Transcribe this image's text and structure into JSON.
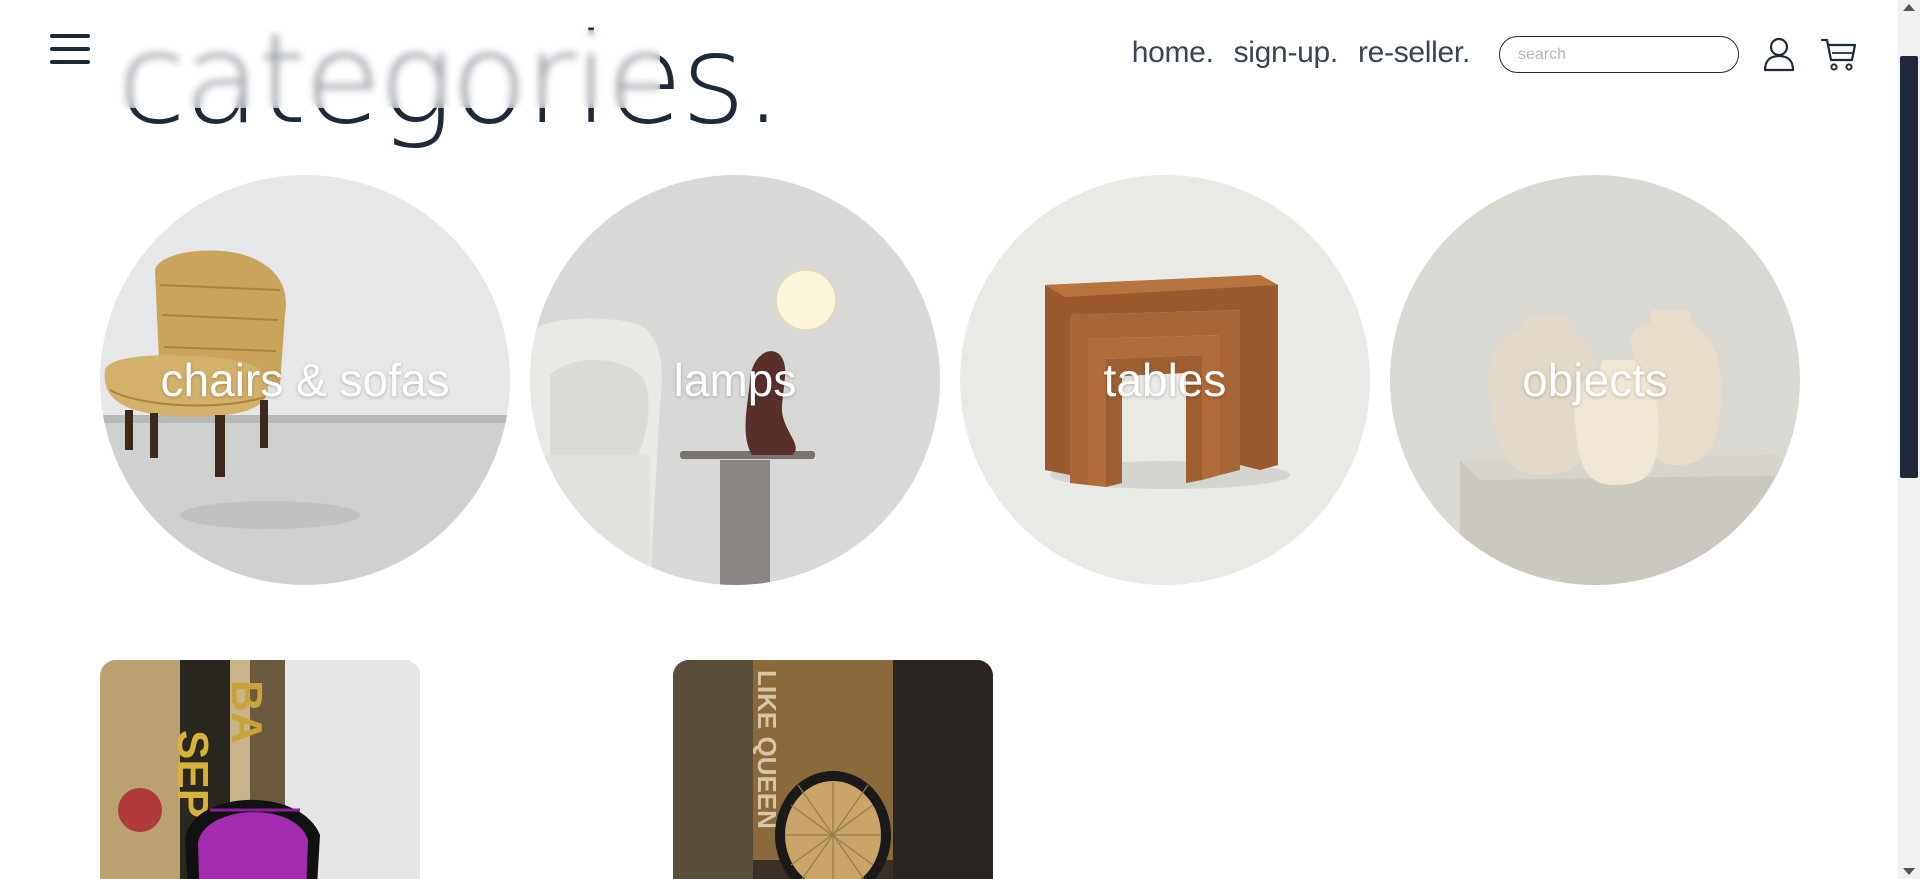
{
  "header": {
    "nav": [
      {
        "label": "home."
      },
      {
        "label": "sign-up."
      },
      {
        "label": "re-seller."
      }
    ],
    "search_placeholder": "search"
  },
  "page": {
    "title": "categories."
  },
  "categories": [
    {
      "label": "chairs & sofas"
    },
    {
      "label": "lamps"
    },
    {
      "label": "tables"
    },
    {
      "label": "objects"
    }
  ],
  "colors": {
    "primary": "#1e2a3a",
    "nav_text": "#3b4452",
    "label_text": "#ffffff"
  },
  "icons": [
    "hamburger-menu-icon",
    "user-icon",
    "shopping-cart-icon"
  ]
}
